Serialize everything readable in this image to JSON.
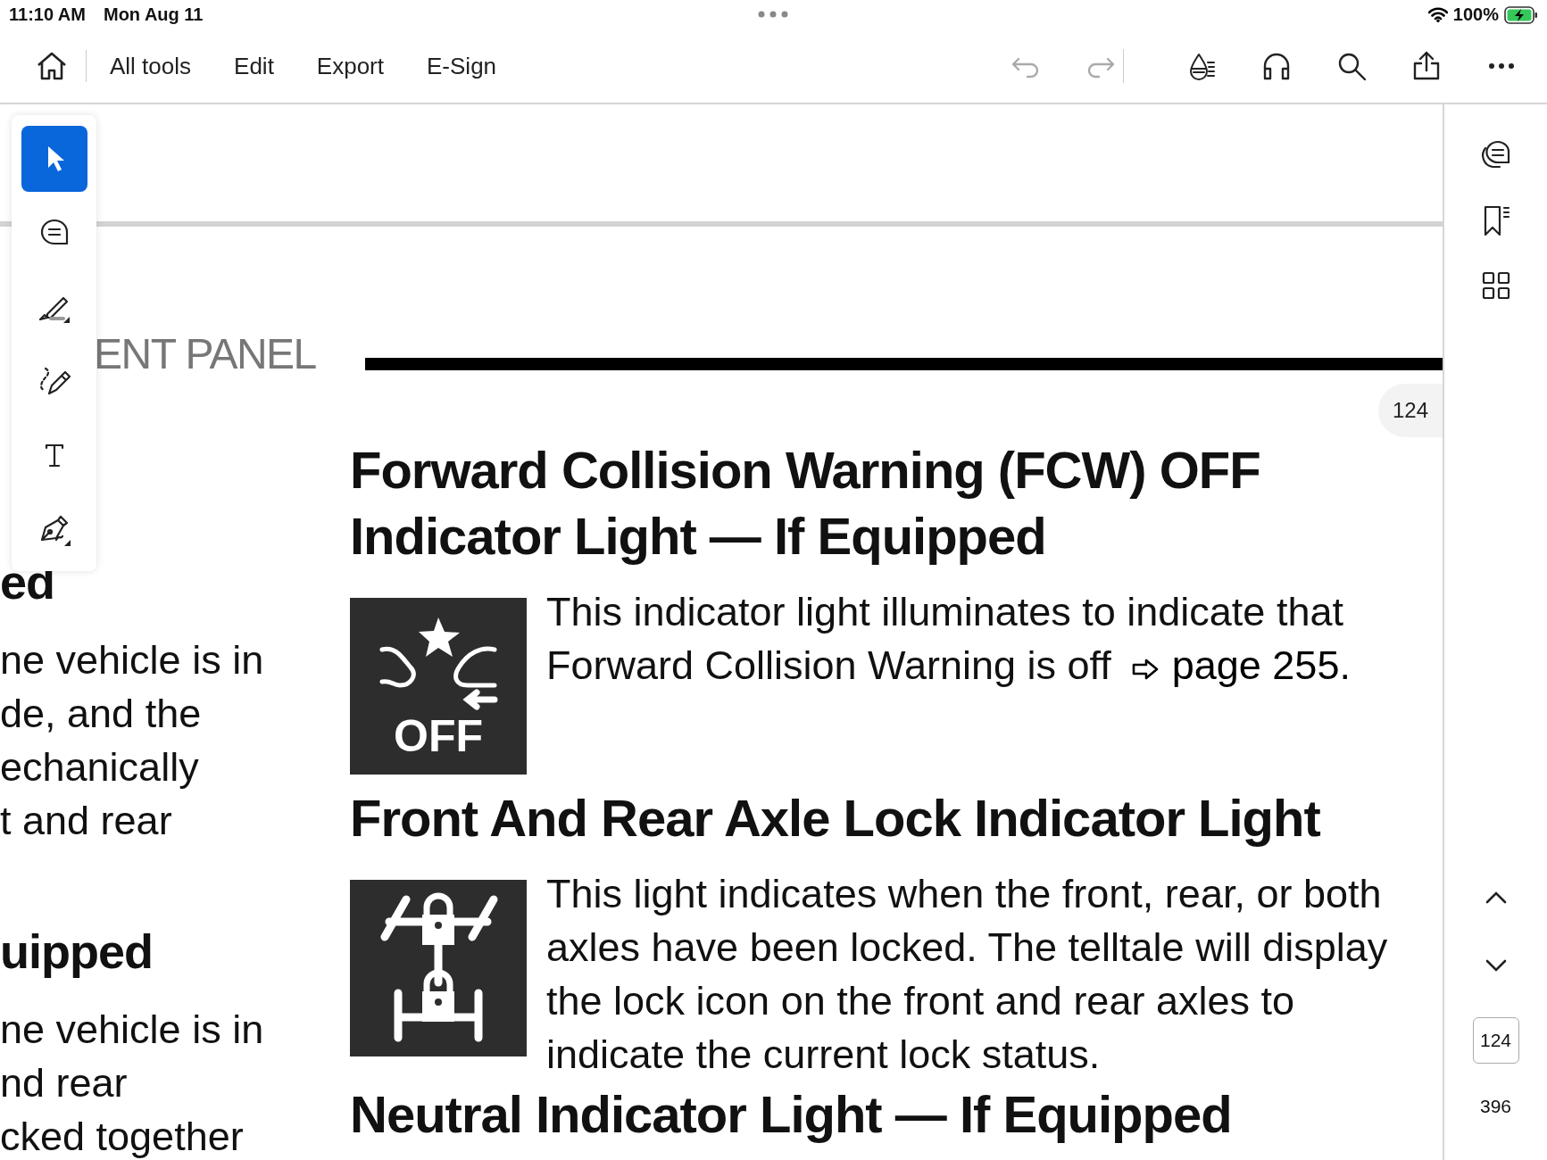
{
  "status_bar": {
    "time": "11:10 AM",
    "date": "Mon Aug 11",
    "battery": "100%",
    "charging": true
  },
  "toolbar": {
    "menu": [
      {
        "label": "All tools"
      },
      {
        "label": "Edit"
      },
      {
        "label": "Export"
      },
      {
        "label": "E-Sign"
      }
    ],
    "actions": [
      {
        "kind": "undo",
        "disabled": true
      },
      {
        "kind": "redo",
        "disabled": true
      },
      {
        "kind": "read-aloud",
        "disabled": false
      },
      {
        "kind": "headphones",
        "disabled": false
      },
      {
        "kind": "search",
        "disabled": false
      },
      {
        "kind": "share",
        "disabled": false
      },
      {
        "kind": "more",
        "disabled": false
      }
    ]
  },
  "tools": [
    {
      "kind": "select",
      "selected": true
    },
    {
      "kind": "comment",
      "selected": false
    },
    {
      "kind": "highlight",
      "selected": false
    },
    {
      "kind": "draw",
      "selected": false
    },
    {
      "kind": "text",
      "selected": false
    },
    {
      "kind": "sign",
      "selected": false
    }
  ],
  "document": {
    "chapter_heading": "ENT PANEL",
    "left_column": [
      {
        "heading": "ed",
        "lines": [
          "ne vehicle is in",
          "de, and the",
          "echanically",
          "t and rear"
        ]
      },
      {
        "heading": "uipped",
        "lines": [
          "ne vehicle is in",
          "nd rear",
          "cked together"
        ]
      }
    ],
    "page_badge": "124",
    "sections": [
      {
        "title": "Forward Collision Warning (FCW) OFF Indicator Light — If Equipped",
        "icon": {
          "kind": "fcw_off",
          "label": "OFF"
        },
        "body": "This indicator light illuminates to indicate that Forward Collision Warning is off",
        "page_ref": "page 255."
      },
      {
        "title": "Front And Rear Axle Lock Indicator Light",
        "icon": {
          "kind": "axle_lock"
        },
        "body": "This light indicates when the front, rear, or both axles have been locked. The telltale will display the lock icon on the front and rear axles to indicate the current lock status."
      },
      {
        "title": "Neutral Indicator Light — If Equipped"
      }
    ]
  },
  "sidebar": {
    "current_page": "124",
    "total_pages": "396"
  }
}
